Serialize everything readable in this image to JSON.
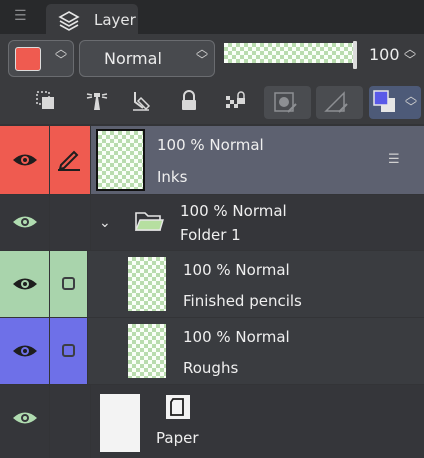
{
  "panel": {
    "tab_title": "Layer"
  },
  "toolbar": {
    "color_swatch": "#ef5b50",
    "blend_mode": "Normal",
    "opacity_value": "100"
  },
  "tools": [
    "clip-to-layer-below-icon",
    "reference-layer-icon",
    "draft-layer-icon",
    "lock-icon",
    "lock-transparent-pixels-icon",
    "mask-enable-icon",
    "ruler-show-icon",
    "layer-color-icon"
  ],
  "layers": [
    {
      "id": "inks",
      "header": "100 %  Normal",
      "name": "Inks",
      "color": "#ef5b50",
      "selected": true
    },
    {
      "id": "folder",
      "header": "100 %  Normal",
      "name": "Folder 1"
    },
    {
      "id": "pencils",
      "header": "100 %  Normal",
      "name": "Finished pencils",
      "color": "#a9d4ac"
    },
    {
      "id": "roughs",
      "header": "100 %  Normal",
      "name": "Roughs",
      "color": "#6e70e8"
    },
    {
      "id": "paper",
      "name": "Paper"
    }
  ],
  "colors": {
    "selected_row": "#5d6170",
    "layer_bg": "#3a3c40",
    "inks": "#ef5b50",
    "pencils": "#a9d4ac",
    "roughs": "#6e70e8"
  }
}
